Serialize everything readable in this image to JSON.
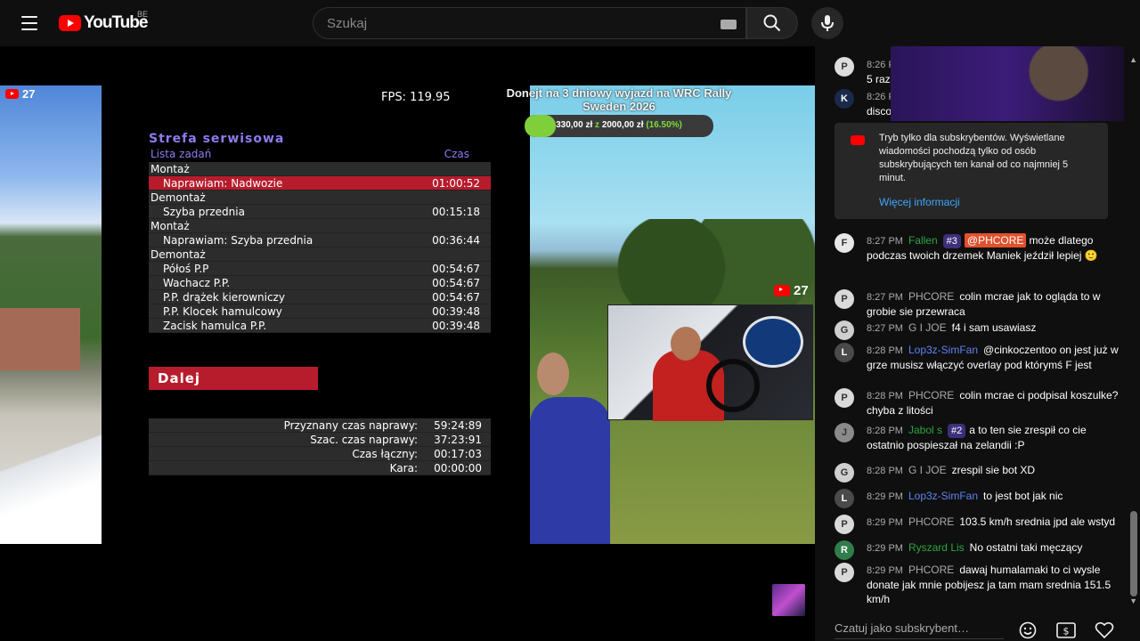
{
  "header": {
    "logo_text": "YouTube",
    "country_code": "BE",
    "search_placeholder": "Szukaj"
  },
  "video": {
    "viewer_badges": [
      "27",
      "27"
    ],
    "fps": "FPS: 119.95",
    "donate": {
      "title": "Donejt na 3 dniowy wyjazd na WRC Rally Sweden 2026",
      "current": "330,00 zł",
      "sep": "z",
      "goal": "2000,00 zł",
      "percent_label": "(16.50%)",
      "progress": 0.165
    },
    "service": {
      "title": "Strefa serwisowa",
      "col_tasks": "Lista zadań",
      "col_time": "Czas",
      "rows": [
        {
          "type": "section",
          "label": "Montaż",
          "time": ""
        },
        {
          "type": "item",
          "label": "Naprawiam: Nadwozie",
          "time": "01:00:52",
          "active": true
        },
        {
          "type": "section",
          "label": "Demontaż",
          "time": ""
        },
        {
          "type": "item",
          "label": "Szyba przednia",
          "time": "00:15:18"
        },
        {
          "type": "section",
          "label": "Montaż",
          "time": ""
        },
        {
          "type": "item",
          "label": "Naprawiam: Szyba przednia",
          "time": "00:36:44"
        },
        {
          "type": "section",
          "label": "Demontaż",
          "time": ""
        },
        {
          "type": "item",
          "label": "Półoś P.P",
          "time": "00:54:67"
        },
        {
          "type": "item",
          "label": "Wachacz P.P.",
          "time": "00:54:67"
        },
        {
          "type": "item",
          "label": "P.P. drążek kierowniczy",
          "time": "00:54:67"
        },
        {
          "type": "item",
          "label": "P.P. Klocek hamulcowy",
          "time": "00:39:48"
        },
        {
          "type": "item",
          "label": "Zacisk hamulca P.P.",
          "time": "00:39:48"
        }
      ],
      "next_label": "Dalej",
      "totals": [
        {
          "label": "Przyznany czas naprawy:",
          "value": "59:24:89"
        },
        {
          "label": "Szac. czas naprawy:",
          "value": "37:23:91"
        },
        {
          "label": "Czas łączny:",
          "value": "00:17:03"
        },
        {
          "label": "Kara:",
          "value": "00:00:00"
        }
      ]
    }
  },
  "chat": {
    "top_messages": [
      {
        "time": "8:26 P",
        "text": "5 raz"
      },
      {
        "time": "8:26 P",
        "text": "disco"
      }
    ],
    "notice": {
      "text": "Tryb tylko dla subskrybentów. Wyświetlane wiadomości pochodzą tylko od osób subskrybujących ten kanał od co najmniej 5 minut.",
      "link": "Więcej informacji"
    },
    "messages": [
      {
        "avatar": "F",
        "time": "8:27 PM",
        "author": "Fallen",
        "role": "member",
        "badge": "#3",
        "mention": "@PHCORE",
        "text": "może dlatego podczas twoich drzemek Maniek jeździł lepiej 🙂"
      },
      {
        "avatar": "P",
        "time": "8:27 PM",
        "author": "PHCORE",
        "role": "",
        "badge": "",
        "mention": "",
        "text": "colin mcrae jak to ogląda to w grobie sie przewraca"
      },
      {
        "avatar": "G",
        "time": "8:27 PM",
        "author": "G I JOE",
        "role": "",
        "badge": "",
        "mention": "",
        "text": "f4 i sam usawiasz"
      },
      {
        "avatar": "L",
        "time": "8:28 PM",
        "author": "Lop3z-SimFan",
        "role": "mod",
        "badge": "",
        "mention": "",
        "text": "@cinkoczentoo on jest już w grze musisz włączyć overlay pod którymś F jest"
      },
      {
        "avatar": "P",
        "time": "8:28 PM",
        "author": "PHCORE",
        "role": "",
        "badge": "",
        "mention": "",
        "text": "colin mcrae ci podpisal koszulke? chyba z litości"
      },
      {
        "avatar": "J",
        "time": "8:28 PM",
        "author": "Jabol s",
        "role": "member",
        "badge": "#2",
        "mention": "",
        "text": "a to ten sie zrespił co cie ostatnio pospieszał na zelandii :P"
      },
      {
        "avatar": "G",
        "time": "8:28 PM",
        "author": "G I JOE",
        "role": "",
        "badge": "",
        "mention": "",
        "text": "zrespil sie bot XD"
      },
      {
        "avatar": "L",
        "time": "8:29 PM",
        "author": "Lop3z-SimFan",
        "role": "mod",
        "badge": "",
        "mention": "",
        "text": "to jest bot jak nic"
      },
      {
        "avatar": "P",
        "time": "8:29 PM",
        "author": "PHCORE",
        "role": "",
        "badge": "",
        "mention": "",
        "text": "103.5 km/h srednia jpd ale wstyd"
      },
      {
        "avatar": "R",
        "time": "8:29 PM",
        "author": "Ryszard Lis",
        "role": "member",
        "badge": "",
        "mention": "",
        "text": "No ostatni taki męczący"
      },
      {
        "avatar": "P",
        "time": "8:29 PM",
        "author": "PHCORE",
        "role": "",
        "badge": "",
        "mention": "",
        "text": "dawaj humalamaki to ci wysle donate jak mnie pobijesz ja tam mam srednia 151.5 km/h"
      }
    ],
    "input_placeholder": "Czatuj jako subskrybent…"
  }
}
